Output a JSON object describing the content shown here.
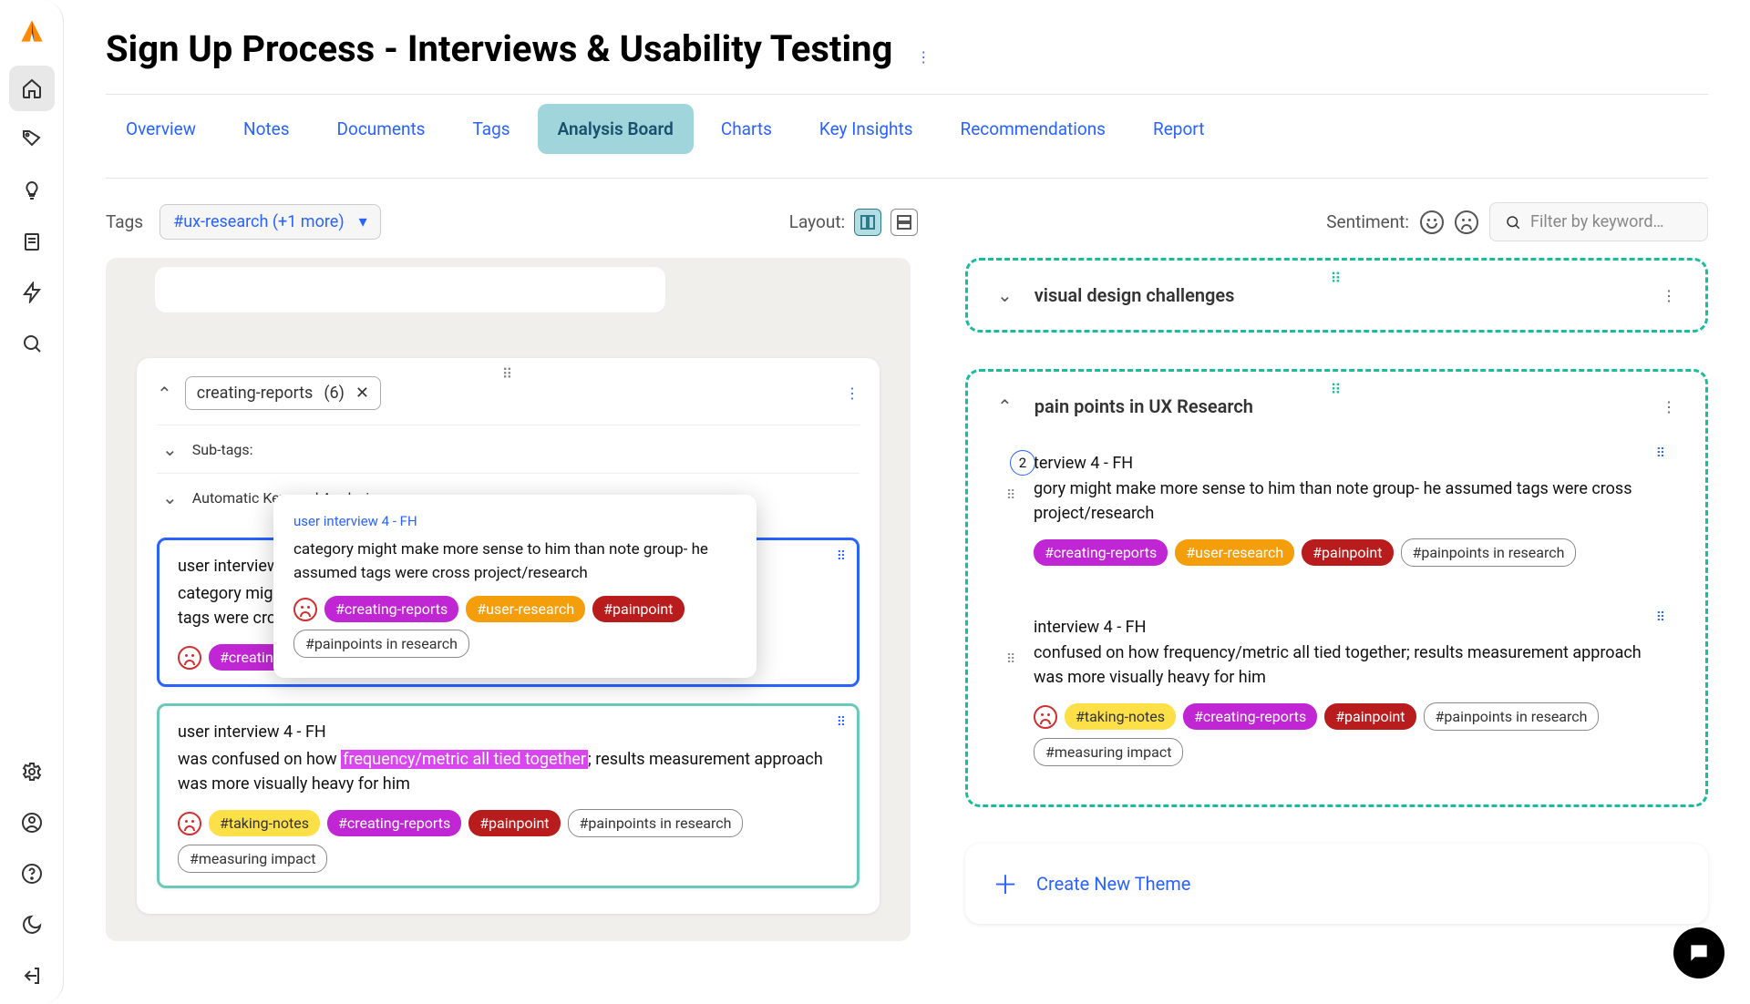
{
  "pageTitle": "Sign Up Process - Interviews & Usability Testing",
  "tabs": [
    "Overview",
    "Notes",
    "Documents",
    "Tags",
    "Analysis Board",
    "Charts",
    "Key Insights",
    "Recommendations",
    "Report"
  ],
  "activeTab": "Analysis Board",
  "toolbar": {
    "tagsLabel": "Tags",
    "tagFilter": "#ux-research (+1 more)",
    "layoutLabel": "Layout:",
    "sentimentLabel": "Sentiment:",
    "searchPlaceholder": "Filter by keyword…"
  },
  "leftGroup": {
    "chipName": "creating-reports",
    "chipCount": "(6)",
    "subTagsLabel": "Sub-tags:",
    "autoKeywordLabel": "Automatic Keyword Analysis:"
  },
  "leftNotes": [
    {
      "selected": true,
      "truncated": true,
      "source": "user interview 4 - FH",
      "body": "category might make more sense to him than note group- he assumed tags were cross project/research",
      "sentiment": "frown",
      "tags": [
        {
          "label": "#creating-reports",
          "style": "magenta"
        },
        {
          "label": "#painpoints in research",
          "style": "outline"
        }
      ]
    },
    {
      "selected": false,
      "teal": true,
      "source": "user interview 4 - FH",
      "bodyPre": "was confused on how ",
      "bodyHL": "frequency/metric all tied together",
      "bodyPost": "; results measurement approach was more visually heavy for him",
      "sentiment": "frown",
      "tags": [
        {
          "label": "#taking-notes",
          "style": "yellow"
        },
        {
          "label": "#creating-reports",
          "style": "magenta"
        },
        {
          "label": "#painpoint",
          "style": "red"
        },
        {
          "label": "#painpoints in research",
          "style": "outline"
        },
        {
          "label": "#measuring impact",
          "style": "outline"
        }
      ]
    }
  ],
  "popover": {
    "source": "user interview 4 - FH",
    "body": "category might make more sense to him than note group- he assumed tags were cross project/research",
    "tags": [
      {
        "label": "#creating-reports",
        "style": "magenta"
      },
      {
        "label": "#user-research",
        "style": "orange"
      },
      {
        "label": "#painpoint",
        "style": "red"
      },
      {
        "label": "#painpoints in research",
        "style": "outline"
      }
    ]
  },
  "themes": [
    {
      "expanded": false,
      "title": "visual design challenges"
    },
    {
      "expanded": true,
      "title": "pain points in UX Research",
      "notes": [
        {
          "badge": "2",
          "sourceSuffix": "terview 4 - FH",
          "bodyPrefix": "gory might make more sense to him than note group- he assumed tags were cross project/research",
          "tags": [
            {
              "label": "#creating-reports",
              "style": "magenta"
            },
            {
              "label": "#user-research",
              "style": "orange"
            },
            {
              "label": "#painpoint",
              "style": "red"
            },
            {
              "label": "#painpoints in research",
              "style": "outline"
            }
          ]
        },
        {
          "sourceFull": "interview 4 - FH",
          "bodyPre": "confused on how ",
          "bodyHL": "frequency/metric all tied together",
          "bodyPost": "; results measurement approach was more visually heavy for him",
          "sentiment": "frown",
          "tags": [
            {
              "label": "#taking-notes",
              "style": "yellow"
            },
            {
              "label": "#creating-reports",
              "style": "magenta"
            },
            {
              "label": "#painpoint",
              "style": "red"
            },
            {
              "label": "#painpoints in research",
              "style": "outline"
            },
            {
              "label": "#measuring impact",
              "style": "outline"
            }
          ]
        }
      ]
    }
  ],
  "createThemeLabel": "Create New Theme"
}
